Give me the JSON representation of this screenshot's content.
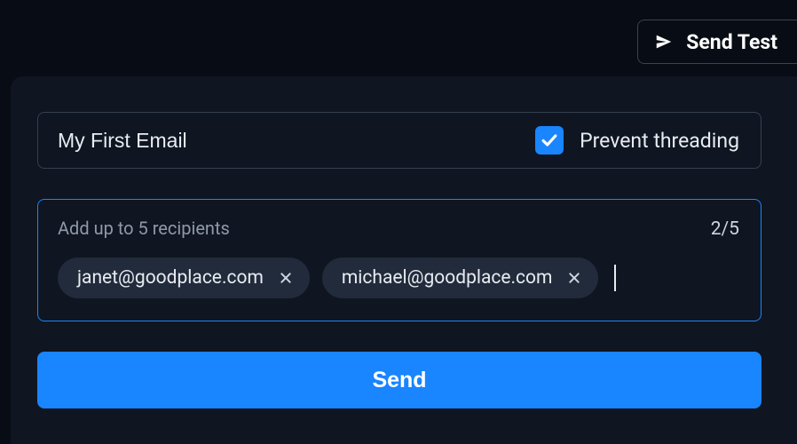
{
  "header": {
    "send_test_label": "Send Test"
  },
  "subject": {
    "value": "My First Email"
  },
  "prevent_threading": {
    "checked": true,
    "label": "Prevent threading"
  },
  "recipients": {
    "hint": "Add up to 5 recipients",
    "count": "2/5",
    "chips": [
      {
        "email": "janet@goodplace.com"
      },
      {
        "email": "michael@goodplace.com"
      }
    ]
  },
  "send": {
    "label": "Send"
  },
  "colors": {
    "accent": "#1985ff"
  }
}
